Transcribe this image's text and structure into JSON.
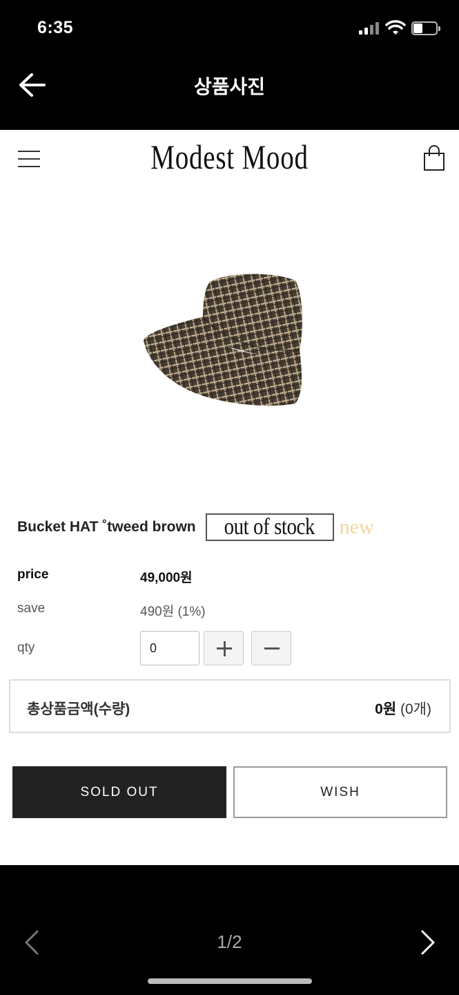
{
  "status_bar": {
    "time": "6:35",
    "battery_level": 0.4
  },
  "nav": {
    "title": "상품사진"
  },
  "store": {
    "logo_text": "Modest Mood"
  },
  "product": {
    "name": "Bucket HAT ˚tweed brown",
    "stock_badge": "out of stock",
    "new_badge": "new",
    "price_label": "price",
    "price_value": "49,000원",
    "save_label": "save",
    "save_value": "490원 (1%)",
    "qty_label": "qty",
    "qty_value": "0"
  },
  "total": {
    "label": "총상품금액(수량)",
    "amount": "0원",
    "count": "(0개)"
  },
  "actions": {
    "sold_out": "SOLD OUT",
    "wish": "WISH"
  },
  "pager": {
    "indicator": "1/2"
  },
  "colors": {
    "background_dark": "#000000",
    "button_dark": "#222222",
    "new_badge": "#f2d79a"
  }
}
